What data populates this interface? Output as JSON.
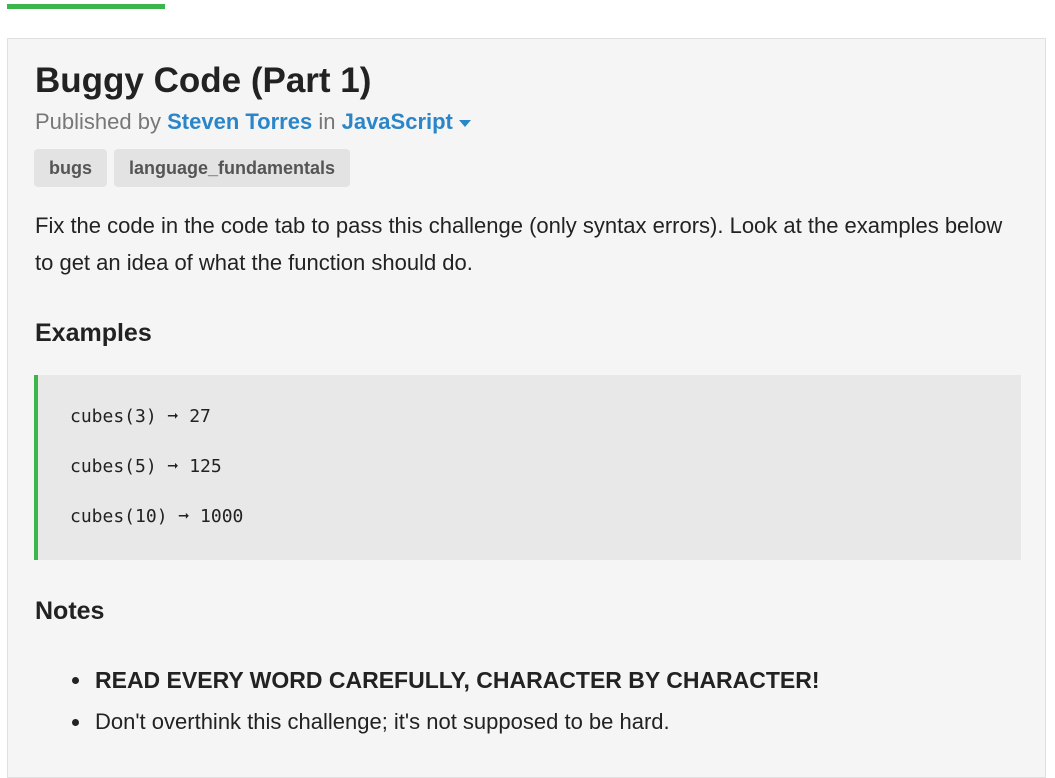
{
  "progress": {
    "fraction": 0.15,
    "color": "#3cb54a"
  },
  "challenge": {
    "title": "Buggy Code (Part 1)",
    "published_prefix": "Published by",
    "author": "Steven Torres",
    "in_word": "in",
    "language": "JavaScript",
    "language_icon": "caret-down-icon",
    "tags": [
      "bugs",
      "language_fundamentals"
    ],
    "description": "Fix the code in the code tab to pass this challenge (only syntax errors). Look at the examples below to get an idea of what the function should do."
  },
  "examples": {
    "heading": "Examples",
    "lines": [
      "cubes(3) ➞ 27",
      "cubes(5) ➞ 125",
      "cubes(10) ➞ 1000"
    ]
  },
  "notes": {
    "heading": "Notes",
    "items": [
      "READ EVERY WORD CAREFULLY, CHARACTER BY CHARACTER!",
      "Don't overthink this challenge; it's not supposed to be hard."
    ]
  }
}
